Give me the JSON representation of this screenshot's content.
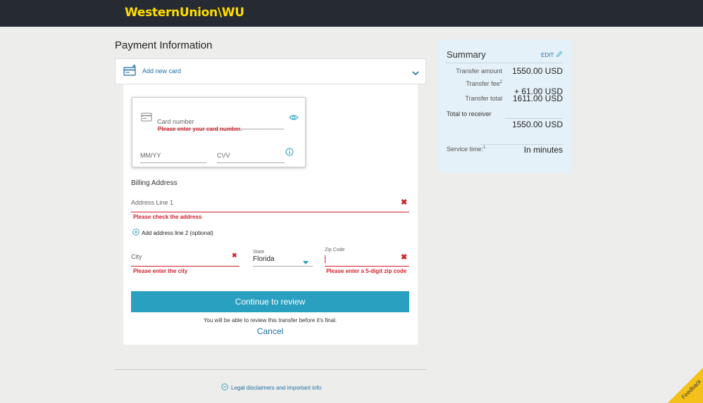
{
  "header": {
    "logo_text": "WesternUnion\\WU"
  },
  "page": {
    "title": "Payment Information"
  },
  "add_card": {
    "label": "Add new card"
  },
  "card_form": {
    "card_number_placeholder": "Card number",
    "card_number_error": "Please enter your card number.",
    "expiry_placeholder": "MM/YY",
    "cvv_placeholder": "CVV"
  },
  "billing": {
    "heading": "Billing Address",
    "address1_placeholder": "Address Line 1",
    "address1_error": "Please check the address",
    "add_line2_label": "Add address line 2 (optional)",
    "city_placeholder": "City",
    "city_error": "Please enter the city",
    "state_label": "State",
    "state_value": "Florida",
    "zip_label": "Zip Code",
    "zip_error": "Please enter a 5-digit zip code"
  },
  "actions": {
    "continue_label": "Continue to review",
    "note": "You will be able to review this transfer before it's final.",
    "cancel_label": "Cancel"
  },
  "footer": {
    "legal_label": "Legal disclaimers and important info"
  },
  "summary": {
    "title": "Summary",
    "edit_label": "EDIT",
    "transfer_amount_label": "Transfer amount",
    "transfer_amount_value": "1550.00  USD",
    "transfer_fee_label": "Transfer fee",
    "transfer_fee_sup": "2",
    "transfer_fee_value": "+ 61.00  USD",
    "transfer_total_label": "Transfer total",
    "transfer_total_value": "1611.00  USD",
    "total_receiver_label": "Total to receiver",
    "total_receiver_value": "1550.00  USD",
    "service_time_label": "Service time:",
    "service_time_sup": "1",
    "service_time_value": "In minutes"
  },
  "feedback": {
    "label": "Feedback"
  },
  "colors": {
    "brand_yellow": "#ffdd00",
    "header_bg": "#262a33",
    "accent_teal": "#2aa0c0",
    "error_red": "#d11f2a",
    "link_blue": "#1f6fa6",
    "summary_bg": "#e5f1f8"
  },
  "icons": [
    "card-add-icon",
    "chevron-down-icon",
    "card-icon",
    "eye-icon",
    "info-icon",
    "close-icon",
    "plus-circle-icon",
    "caret-down-icon",
    "minus-circle-icon",
    "pencil-icon"
  ]
}
